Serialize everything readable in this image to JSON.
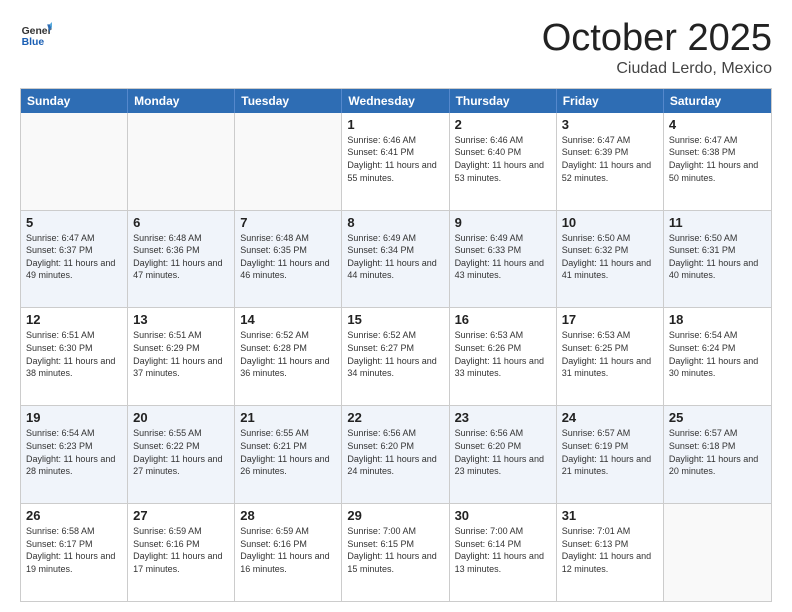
{
  "header": {
    "logo_general": "General",
    "logo_blue": "Blue",
    "title": "October 2025",
    "location": "Ciudad Lerdo, Mexico"
  },
  "days_of_week": [
    "Sunday",
    "Monday",
    "Tuesday",
    "Wednesday",
    "Thursday",
    "Friday",
    "Saturday"
  ],
  "weeks": [
    {
      "alt": false,
      "cells": [
        {
          "day": "",
          "empty": true
        },
        {
          "day": "",
          "empty": true
        },
        {
          "day": "",
          "empty": true
        },
        {
          "day": "1",
          "sunrise": "6:46 AM",
          "sunset": "6:41 PM",
          "daylight": "11 hours and 55 minutes."
        },
        {
          "day": "2",
          "sunrise": "6:46 AM",
          "sunset": "6:40 PM",
          "daylight": "11 hours and 53 minutes."
        },
        {
          "day": "3",
          "sunrise": "6:47 AM",
          "sunset": "6:39 PM",
          "daylight": "11 hours and 52 minutes."
        },
        {
          "day": "4",
          "sunrise": "6:47 AM",
          "sunset": "6:38 PM",
          "daylight": "11 hours and 50 minutes."
        }
      ]
    },
    {
      "alt": true,
      "cells": [
        {
          "day": "5",
          "sunrise": "6:47 AM",
          "sunset": "6:37 PM",
          "daylight": "11 hours and 49 minutes."
        },
        {
          "day": "6",
          "sunrise": "6:48 AM",
          "sunset": "6:36 PM",
          "daylight": "11 hours and 47 minutes."
        },
        {
          "day": "7",
          "sunrise": "6:48 AM",
          "sunset": "6:35 PM",
          "daylight": "11 hours and 46 minutes."
        },
        {
          "day": "8",
          "sunrise": "6:49 AM",
          "sunset": "6:34 PM",
          "daylight": "11 hours and 44 minutes."
        },
        {
          "day": "9",
          "sunrise": "6:49 AM",
          "sunset": "6:33 PM",
          "daylight": "11 hours and 43 minutes."
        },
        {
          "day": "10",
          "sunrise": "6:50 AM",
          "sunset": "6:32 PM",
          "daylight": "11 hours and 41 minutes."
        },
        {
          "day": "11",
          "sunrise": "6:50 AM",
          "sunset": "6:31 PM",
          "daylight": "11 hours and 40 minutes."
        }
      ]
    },
    {
      "alt": false,
      "cells": [
        {
          "day": "12",
          "sunrise": "6:51 AM",
          "sunset": "6:30 PM",
          "daylight": "11 hours and 38 minutes."
        },
        {
          "day": "13",
          "sunrise": "6:51 AM",
          "sunset": "6:29 PM",
          "daylight": "11 hours and 37 minutes."
        },
        {
          "day": "14",
          "sunrise": "6:52 AM",
          "sunset": "6:28 PM",
          "daylight": "11 hours and 36 minutes."
        },
        {
          "day": "15",
          "sunrise": "6:52 AM",
          "sunset": "6:27 PM",
          "daylight": "11 hours and 34 minutes."
        },
        {
          "day": "16",
          "sunrise": "6:53 AM",
          "sunset": "6:26 PM",
          "daylight": "11 hours and 33 minutes."
        },
        {
          "day": "17",
          "sunrise": "6:53 AM",
          "sunset": "6:25 PM",
          "daylight": "11 hours and 31 minutes."
        },
        {
          "day": "18",
          "sunrise": "6:54 AM",
          "sunset": "6:24 PM",
          "daylight": "11 hours and 30 minutes."
        }
      ]
    },
    {
      "alt": true,
      "cells": [
        {
          "day": "19",
          "sunrise": "6:54 AM",
          "sunset": "6:23 PM",
          "daylight": "11 hours and 28 minutes."
        },
        {
          "day": "20",
          "sunrise": "6:55 AM",
          "sunset": "6:22 PM",
          "daylight": "11 hours and 27 minutes."
        },
        {
          "day": "21",
          "sunrise": "6:55 AM",
          "sunset": "6:21 PM",
          "daylight": "11 hours and 26 minutes."
        },
        {
          "day": "22",
          "sunrise": "6:56 AM",
          "sunset": "6:20 PM",
          "daylight": "11 hours and 24 minutes."
        },
        {
          "day": "23",
          "sunrise": "6:56 AM",
          "sunset": "6:20 PM",
          "daylight": "11 hours and 23 minutes."
        },
        {
          "day": "24",
          "sunrise": "6:57 AM",
          "sunset": "6:19 PM",
          "daylight": "11 hours and 21 minutes."
        },
        {
          "day": "25",
          "sunrise": "6:57 AM",
          "sunset": "6:18 PM",
          "daylight": "11 hours and 20 minutes."
        }
      ]
    },
    {
      "alt": false,
      "cells": [
        {
          "day": "26",
          "sunrise": "6:58 AM",
          "sunset": "6:17 PM",
          "daylight": "11 hours and 19 minutes."
        },
        {
          "day": "27",
          "sunrise": "6:59 AM",
          "sunset": "6:16 PM",
          "daylight": "11 hours and 17 minutes."
        },
        {
          "day": "28",
          "sunrise": "6:59 AM",
          "sunset": "6:16 PM",
          "daylight": "11 hours and 16 minutes."
        },
        {
          "day": "29",
          "sunrise": "7:00 AM",
          "sunset": "6:15 PM",
          "daylight": "11 hours and 15 minutes."
        },
        {
          "day": "30",
          "sunrise": "7:00 AM",
          "sunset": "6:14 PM",
          "daylight": "11 hours and 13 minutes."
        },
        {
          "day": "31",
          "sunrise": "7:01 AM",
          "sunset": "6:13 PM",
          "daylight": "11 hours and 12 minutes."
        },
        {
          "day": "",
          "empty": true
        }
      ]
    }
  ]
}
